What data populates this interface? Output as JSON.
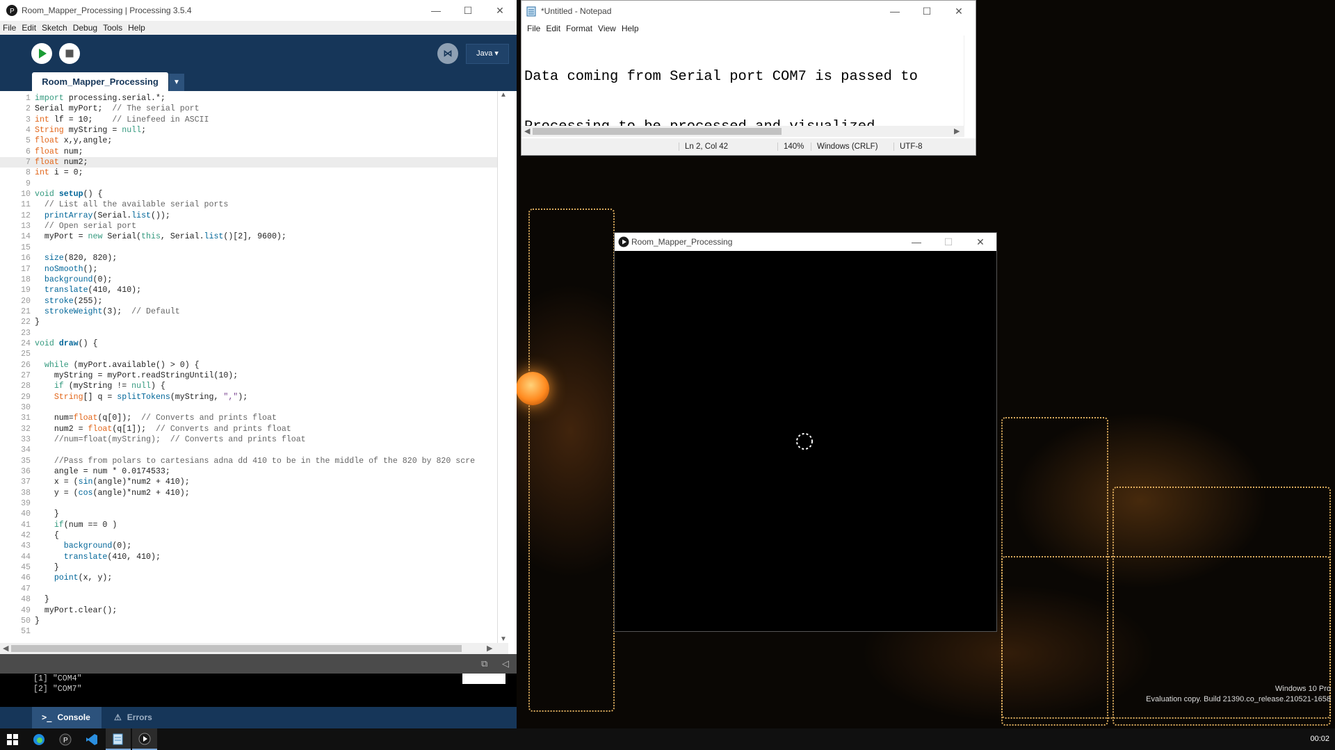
{
  "pde": {
    "title": "Room_Mapper_Processing | Processing 3.5.4",
    "menu": [
      "File",
      "Edit",
      "Sketch",
      "Debug",
      "Tools",
      "Help"
    ],
    "mode": "Java",
    "tab": "Room_Mapper_Processing",
    "code_lines": [
      "import processing.serial.*;",
      "Serial myPort;  // The serial port",
      "int lf = 10;    // Linefeed in ASCII",
      "String myString = null;",
      "float x,y,angle;",
      "float num;",
      "float num2;",
      "int i = 0;",
      "",
      "void setup() {",
      "  // List all the available serial ports",
      "  printArray(Serial.list());",
      "  // Open serial port",
      "  myPort = new Serial(this, Serial.list()[2], 9600);",
      "",
      "  size(820, 820);",
      "  noSmooth();",
      "  background(0);",
      "  translate(410, 410);",
      "  stroke(255);",
      "  strokeWeight(3);  // Default",
      "}",
      "",
      "void draw() {",
      "",
      "  while (myPort.available() > 0) {",
      "    myString = myPort.readStringUntil(10);",
      "    if (myString != null) {",
      "    String[] q = splitTokens(myString, \",\");",
      "",
      "    num=float(q[0]);  // Converts and prints float",
      "    num2 = float(q[1]);  // Converts and prints float",
      "    //num=float(myString);  // Converts and prints float",
      "",
      "    //Pass from polars to cartesians adna dd 410 to be in the middle of the 820 by 820 scre",
      "    angle = num * 0.0174533;",
      "    x = (sin(angle)*num2 + 410);",
      "    y = (cos(angle)*num2 + 410);",
      "",
      "    }",
      "    if(num == 0 )",
      "    {",
      "      background(0);",
      "      translate(410, 410);",
      "    }",
      "    point(x, y);",
      "",
      "  }",
      "  myPort.clear();",
      "}",
      ""
    ],
    "highlighted_line": 7,
    "console_lines": [
      "[1] \"COM4\"",
      "[2] \"COM7\""
    ],
    "footer_tabs": [
      "Console",
      "Errors"
    ]
  },
  "notepad": {
    "title": "*Untitled - Notepad",
    "menu": [
      "File",
      "Edit",
      "Format",
      "View",
      "Help"
    ],
    "text_line1": "Data coming from Serial port COM7 is passed to",
    "text_line2": "Processing to be processed and visualized",
    "status": {
      "position": "Ln 2, Col 42",
      "zoom": "140%",
      "line_ending": "Windows (CRLF)",
      "encoding": "UTF-8"
    }
  },
  "sketch": {
    "title": "Room_Mapper_Processing"
  },
  "desktop": {
    "watermark_line1": "Windows 10 Pro",
    "watermark_line2": "Evaluation copy. Build 21390.co_release.210521-1658"
  },
  "taskbar": {
    "clock": "00:02",
    "icons": [
      "windows-start-icon",
      "edge-icon",
      "processing-icon",
      "vscode-icon",
      "notepad-icon",
      "sketch-app-icon"
    ]
  },
  "colors": {
    "processing_blue": "#163659",
    "processing_tab_blue": "#2c527c",
    "keyword": "#33997e",
    "type": "#e2661a",
    "function": "#006699"
  }
}
